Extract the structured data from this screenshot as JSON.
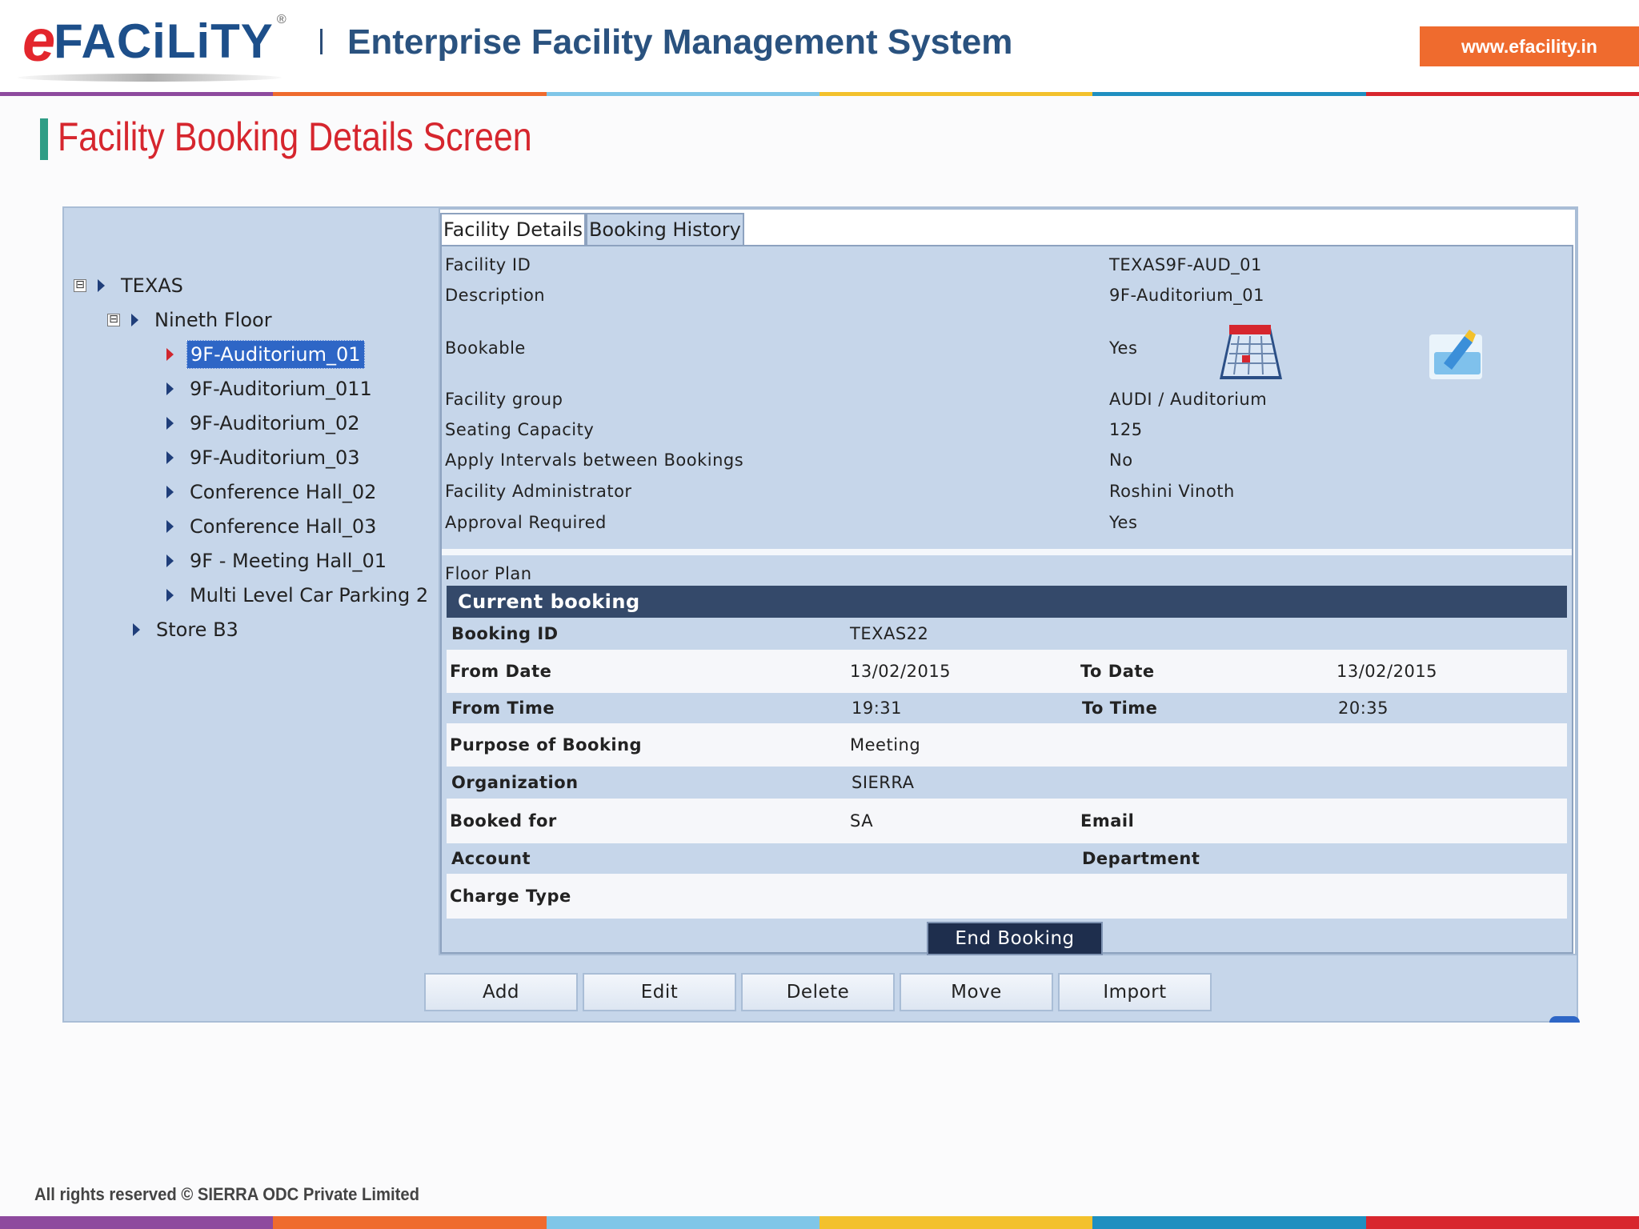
{
  "header": {
    "logo_e": "e",
    "logo_word": "FACiLiTY",
    "logo_reg": "®",
    "separator": "|",
    "app_title": "Enterprise Facility Management System",
    "website": "www.efacility.in"
  },
  "brand_colors": {
    "stripe": [
      "#8e4a9e",
      "#ef6b2e",
      "#7fc6e8",
      "#f3c12c",
      "#1f8fc0",
      "#d8262e"
    ],
    "title_red": "#d6262e",
    "selection_blue": "#2e66c6",
    "panel_blue": "#c6d6ea",
    "booking_header": "#34496a"
  },
  "page_title": "Facility Booking Details Screen",
  "tree": {
    "root": {
      "label": "TEXAS",
      "toggle": "⊟"
    },
    "floor": {
      "label": "Nineth Floor",
      "toggle": "⊟"
    },
    "items": [
      {
        "label": "9F-Auditorium_01",
        "selected": true
      },
      {
        "label": "9F-Auditorium_011"
      },
      {
        "label": "9F-Auditorium_02"
      },
      {
        "label": "9F-Auditorium_03"
      },
      {
        "label": "Conference Hall_02"
      },
      {
        "label": "Conference Hall_03"
      },
      {
        "label": "9F - Meeting Hall_01"
      },
      {
        "label": "Multi Level Car Parking 2"
      }
    ],
    "sibling": {
      "label": "Store B3"
    }
  },
  "tabs": [
    {
      "label": "Facility Details",
      "active": true
    },
    {
      "label": "Booking History",
      "active": false
    }
  ],
  "facility_details": [
    {
      "label": "Facility ID",
      "value": "TEXAS9F-AUD_01"
    },
    {
      "label": "Description",
      "value": "9F-Auditorium_01"
    },
    {
      "label": "Bookable",
      "value": "Yes"
    },
    {
      "label": "Facility group",
      "value": "AUDI / Auditorium"
    },
    {
      "label": "Seating Capacity",
      "value": "125"
    },
    {
      "label": "Apply Intervals between Bookings",
      "value": "No"
    },
    {
      "label": "Facility Administrator",
      "value": "Roshini Vinoth"
    },
    {
      "label": "Approval Required",
      "value": "Yes"
    }
  ],
  "icons": {
    "calendar": "calendar-icon",
    "checkin": "check-in-icon"
  },
  "floor_plan_label": "Floor Plan",
  "current_booking": {
    "title": "Current booking",
    "booking_id_label": "Booking ID",
    "booking_id": "TEXAS22",
    "from_date_label": "From Date",
    "from_date": "13/02/2015",
    "to_date_label": "To Date",
    "to_date": "13/02/2015",
    "from_time_label": "From Time",
    "from_time": "19:31",
    "to_time_label": "To Time",
    "to_time": "20:35",
    "purpose_label": "Purpose of Booking",
    "purpose": "Meeting",
    "organization_label": "Organization",
    "organization": "SIERRA",
    "booked_for_label": "Booked for",
    "booked_for": "SA",
    "email_label": "Email",
    "email": "",
    "account_label": "Account",
    "account": "",
    "department_label": "Department",
    "department": "",
    "charge_type_label": "Charge Type",
    "charge_type": "",
    "end_button": "End Booking"
  },
  "actions": [
    "Add",
    "Edit",
    "Delete",
    "Move",
    "Import"
  ],
  "footer": {
    "copyright": "All rights reserved © SIERRA ODC Private Limited"
  }
}
